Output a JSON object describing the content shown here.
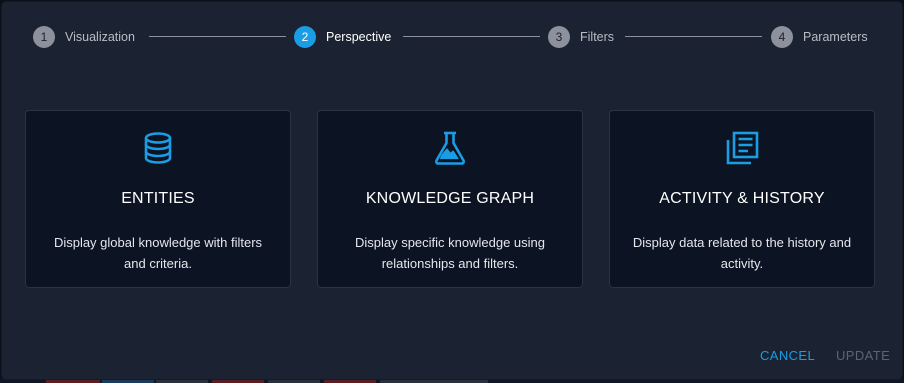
{
  "stepper": {
    "steps": [
      {
        "number": "1",
        "label": "Visualization",
        "active": false
      },
      {
        "number": "2",
        "label": "Perspective",
        "active": true
      },
      {
        "number": "3",
        "label": "Filters",
        "active": false
      },
      {
        "number": "4",
        "label": "Parameters",
        "active": false
      }
    ]
  },
  "cards": [
    {
      "icon": "database-icon",
      "title": "ENTITIES",
      "description": "Display global knowledge with filters and criteria."
    },
    {
      "icon": "flask-icon",
      "title": "KNOWLEDGE GRAPH",
      "description": "Display specific knowledge using relationships and filters."
    },
    {
      "icon": "library-books-icon",
      "title": "ACTIVITY & HISTORY",
      "description": "Display data related to the history and activity."
    }
  ],
  "footer": {
    "cancel_label": "CANCEL",
    "update_label": "UPDATE"
  },
  "colors": {
    "accent": "#1a9de4",
    "dialog_background": "#1b2231",
    "card_background": "#0c1322",
    "inactive_step": "#8c919b",
    "disabled_text": "#5c6472"
  }
}
